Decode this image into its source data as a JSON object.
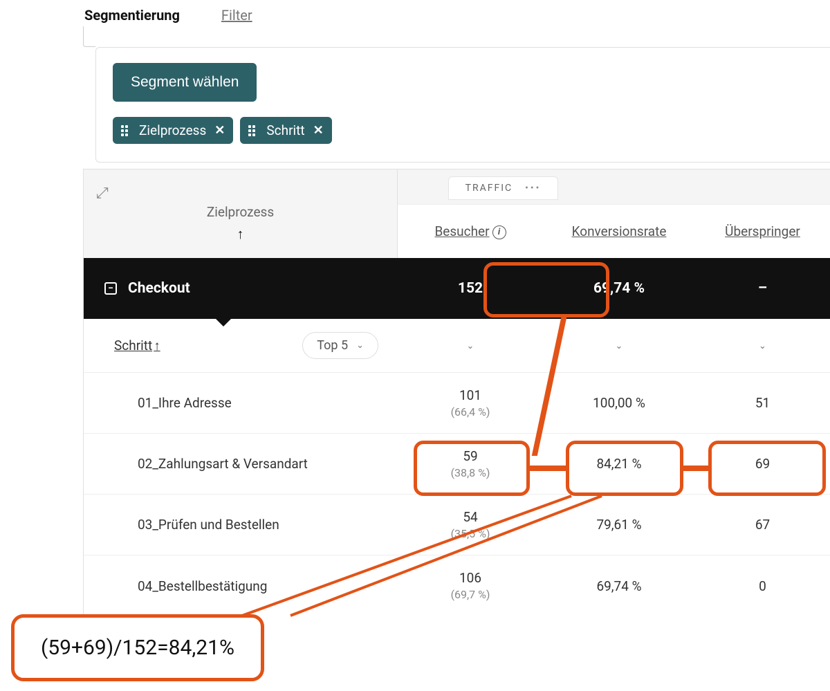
{
  "tabs": {
    "segmentation": "Segmentierung",
    "filter": "Filter"
  },
  "segment": {
    "choose_button": "Segment wählen",
    "chips": [
      "Zielprozess",
      "Schritt"
    ]
  },
  "table": {
    "dim_label": "Zielprozess",
    "traffic_label": "TRAFFIC",
    "columns": {
      "besucher": "Besucher",
      "konv": "Konversionsrate",
      "ueber": "Überspringer"
    },
    "summary": {
      "name": "Checkout",
      "besucher": "152",
      "konv": "69,74 %",
      "ueber": "–"
    },
    "subhead": {
      "schritt": "Schritt",
      "top5": "Top 5"
    },
    "rows": [
      {
        "name": "01_Ihre Adresse",
        "besucher": "101",
        "pct": "(66,4 %)",
        "konv": "100,00 %",
        "ueber": "51"
      },
      {
        "name": "02_Zahlungsart & Versandart",
        "besucher": "59",
        "pct": "(38,8 %)",
        "konv": "84,21 %",
        "ueber": "69"
      },
      {
        "name": "03_Prüfen und Bestellen",
        "besucher": "54",
        "pct": "(35,5 %)",
        "konv": "79,61 %",
        "ueber": "67"
      },
      {
        "name": "04_Bestellbestätigung",
        "besucher": "106",
        "pct": "(69,7 %)",
        "konv": "69,74 %",
        "ueber": "0"
      }
    ]
  },
  "annotation": {
    "formula": "(59+69)/152=84,21%"
  }
}
